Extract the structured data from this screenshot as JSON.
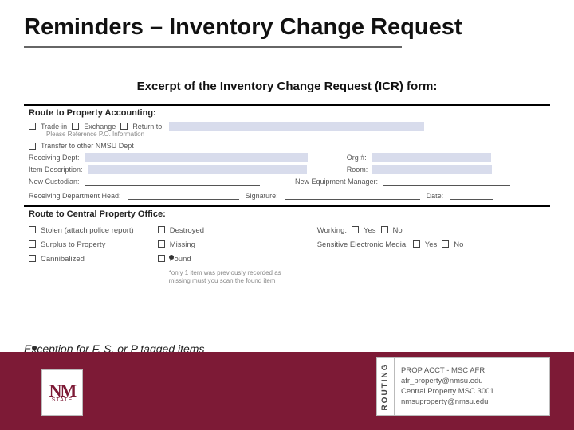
{
  "title": "Reminders – Inventory Change Request",
  "subtitle": "Excerpt of the Inventory Change Request (ICR) form:",
  "form": {
    "section1_heading": "Route to Property Accounting:",
    "trade_in": "Trade-in",
    "exchange": "Exchange",
    "return": "Return to:",
    "ref_po": "Please Reference P.O. Information",
    "transfer": "Transfer to other NMSU Dept",
    "receiving_dept": "Receiving Dept:",
    "org": "Org #:",
    "item_desc": "Item Description:",
    "room": "Room:",
    "new_custodian": "New Custodian:",
    "new_equip_mgr": "New Equipment Manager:",
    "recv_dept_head": "Receiving Department Head:",
    "signature": "Signature:",
    "date": "Date:",
    "section2_heading": "Route to Central Property Office:",
    "stolen": "Stolen (attach police report)",
    "surplus": "Surplus to Property",
    "cannibalized": "Cannibalized",
    "destroyed": "Destroyed",
    "missing": "Missing",
    "found": "Found",
    "found_note": "*only 1 item was previously recorded as missing must you scan the found item",
    "working": "Working:",
    "sem": "Sensitive Electronic Media:",
    "yes": "Yes",
    "no": "No"
  },
  "exception": "Exception for F, S, or P tagged items",
  "logo": {
    "nm": "NM",
    "state": "STATE"
  },
  "routing": {
    "side": "ROUTING",
    "l1": "PROP ACCT - MSC AFR",
    "l2": "afr_property@nmsu.edu",
    "l3": "Central Property MSC 3001",
    "l4": "nmsuproperty@nmsu.edu"
  }
}
